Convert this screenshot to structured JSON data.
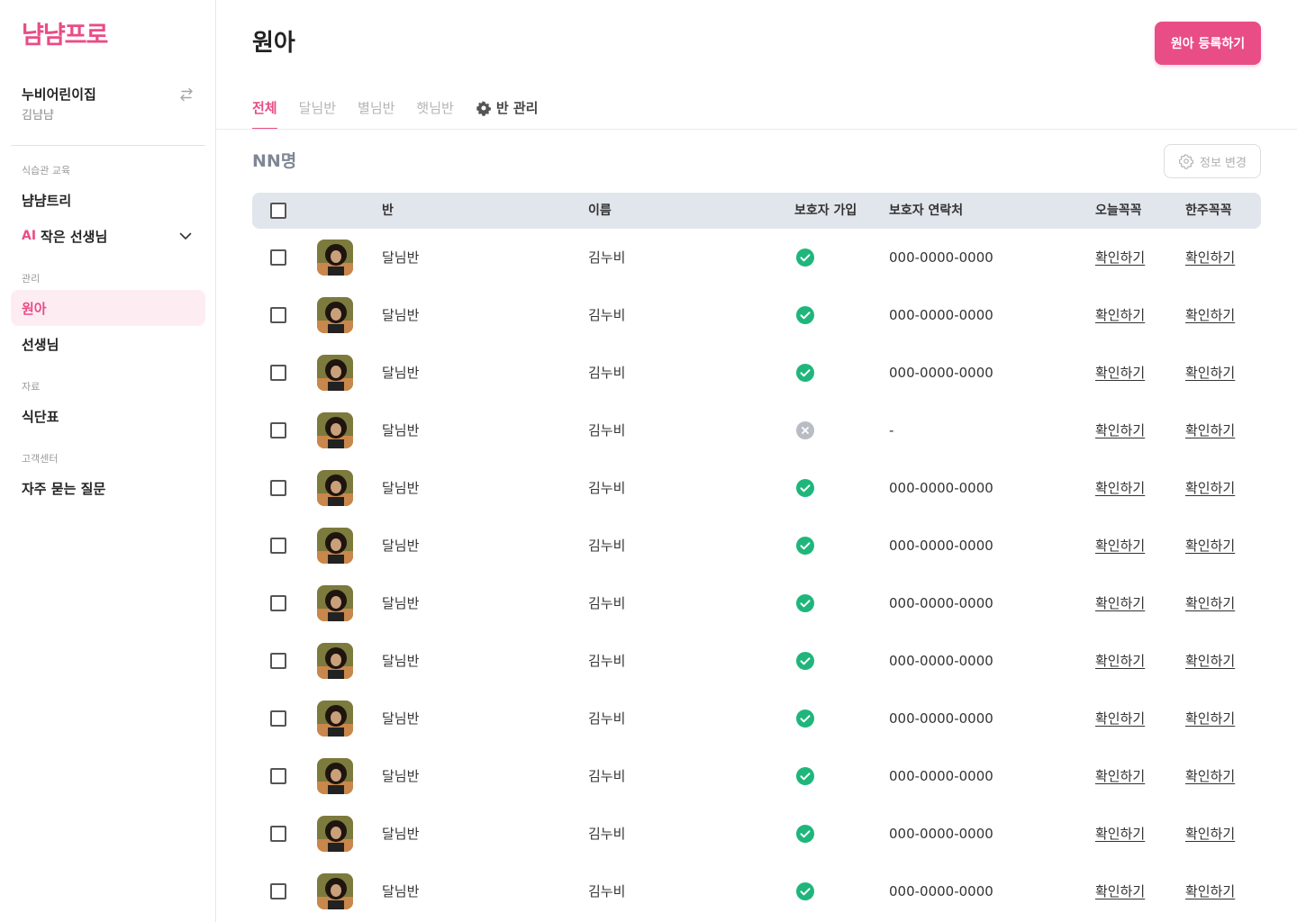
{
  "colors": {
    "accent": "#e94d86",
    "accent_soft": "#fdedf2",
    "success": "#1fb67b",
    "neutral": "#b8bcc4",
    "header_bg": "#e1e5ec"
  },
  "sidebar": {
    "logo": "냠냠프로",
    "org_name": "누비어린이집",
    "org_user": "김냠냠",
    "sections": [
      {
        "label": "식습관 교육",
        "items": [
          {
            "label": "냠냠트리"
          },
          {
            "badge": "AI",
            "label": "작은 선생님"
          }
        ]
      },
      {
        "label": "관리",
        "items": [
          {
            "label": "원아"
          },
          {
            "label": "선생님"
          }
        ]
      },
      {
        "label": "자료",
        "items": [
          {
            "label": "식단표"
          }
        ]
      },
      {
        "label": "고객센터",
        "items": [
          {
            "label": "자주 묻는 질문"
          }
        ]
      }
    ]
  },
  "header": {
    "title": "원아",
    "register_button": "원아 등록하기"
  },
  "tabs": [
    {
      "label": "전체"
    },
    {
      "label": "달님반"
    },
    {
      "label": "별님반"
    },
    {
      "label": "햇님반"
    },
    {
      "label": "반 관리",
      "icon": "gear-icon"
    }
  ],
  "count_label": "NN명",
  "info_button": "정보 변경",
  "table": {
    "columns": [
      "반",
      "이름",
      "보호자 가입",
      "보호자 연락처",
      "오늘꼭꼭",
      "한주꼭꼭"
    ],
    "rows": [
      {
        "class": "달님반",
        "name": "김누비",
        "joined": "check-circle-icon",
        "phone": "000-0000-0000",
        "today": "확인하기",
        "week": "확인하기"
      },
      {
        "class": "달님반",
        "name": "김누비",
        "joined": "check-circle-icon",
        "phone": "000-0000-0000",
        "today": "확인하기",
        "week": "확인하기"
      },
      {
        "class": "달님반",
        "name": "김누비",
        "joined": "check-circle-icon",
        "phone": "000-0000-0000",
        "today": "확인하기",
        "week": "확인하기"
      },
      {
        "class": "달님반",
        "name": "김누비",
        "joined": "x-circle-icon",
        "phone": "-",
        "today": "확인하기",
        "week": "확인하기"
      },
      {
        "class": "달님반",
        "name": "김누비",
        "joined": "check-circle-icon",
        "phone": "000-0000-0000",
        "today": "확인하기",
        "week": "확인하기"
      },
      {
        "class": "달님반",
        "name": "김누비",
        "joined": "check-circle-icon",
        "phone": "000-0000-0000",
        "today": "확인하기",
        "week": "확인하기"
      },
      {
        "class": "달님반",
        "name": "김누비",
        "joined": "check-circle-icon",
        "phone": "000-0000-0000",
        "today": "확인하기",
        "week": "확인하기"
      },
      {
        "class": "달님반",
        "name": "김누비",
        "joined": "check-circle-icon",
        "phone": "000-0000-0000",
        "today": "확인하기",
        "week": "확인하기"
      },
      {
        "class": "달님반",
        "name": "김누비",
        "joined": "check-circle-icon",
        "phone": "000-0000-0000",
        "today": "확인하기",
        "week": "확인하기"
      },
      {
        "class": "달님반",
        "name": "김누비",
        "joined": "check-circle-icon",
        "phone": "000-0000-0000",
        "today": "확인하기",
        "week": "확인하기"
      },
      {
        "class": "달님반",
        "name": "김누비",
        "joined": "check-circle-icon",
        "phone": "000-0000-0000",
        "today": "확인하기",
        "week": "확인하기"
      },
      {
        "class": "달님반",
        "name": "김누비",
        "joined": "check-circle-icon",
        "phone": "000-0000-0000",
        "today": "확인하기",
        "week": "확인하기"
      }
    ]
  }
}
